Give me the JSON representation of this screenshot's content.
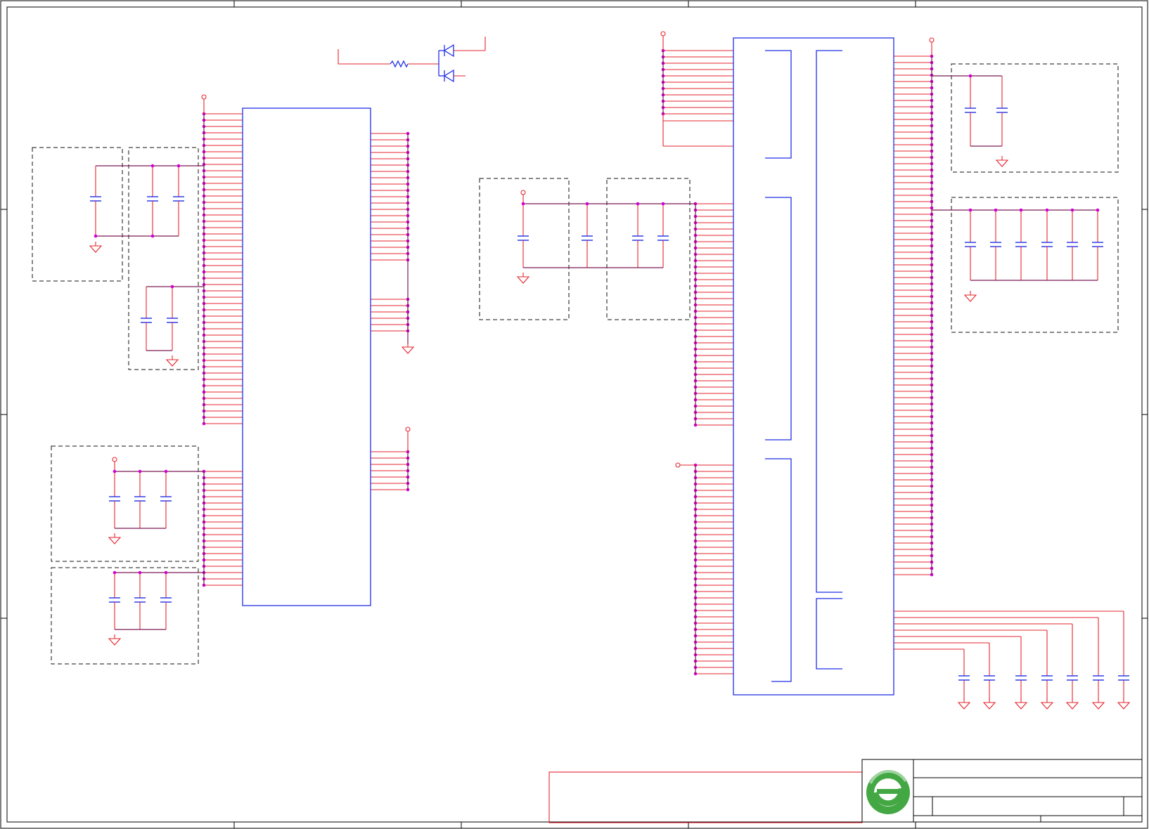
{
  "sheet": {
    "border_color": "#000000",
    "wire_color": "#e6252d",
    "component_color": "#1f2fe6",
    "junction_color": "#d400d4",
    "frame_style": "schematic-drawing-frame"
  },
  "title_block": {
    "logo_icon": "green-e-logo-icon",
    "logo_colors": [
      "#43a843",
      "#9fd39f"
    ]
  },
  "components": {
    "ic_left": "integrated-circuit",
    "ic_right": "integrated-circuit",
    "resistor": "resistor-symbol",
    "diodes": "diode-pair-symbol",
    "capacitor": "capacitor-symbol",
    "ground": "ground-symbol",
    "power": "power-port-symbol"
  }
}
